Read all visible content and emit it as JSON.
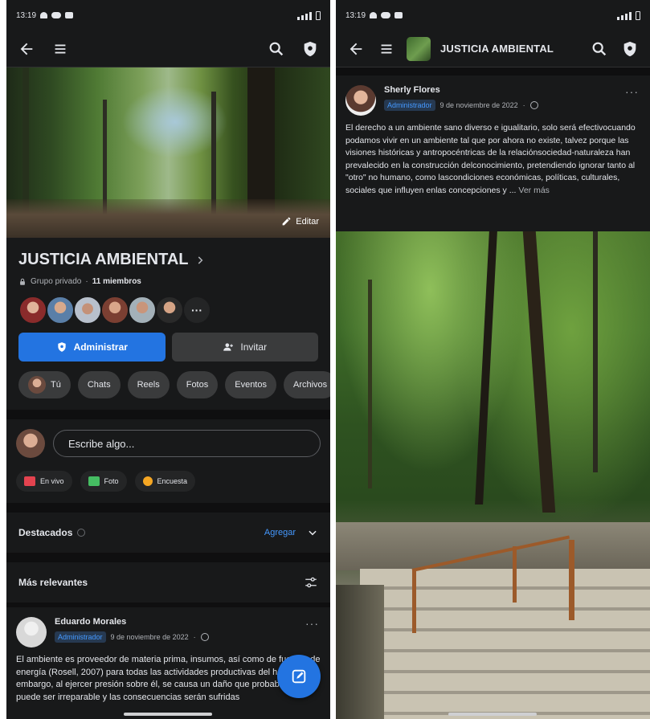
{
  "status_bar": {
    "time": "13:19"
  },
  "left": {
    "cover": {
      "edit_label": "Editar"
    },
    "group": {
      "name": "JUSTICIA AMBIENTAL",
      "privacy": "Grupo privado",
      "members": "11 miembros"
    },
    "buttons": {
      "admin": "Administrar",
      "invite": "Invitar"
    },
    "chips": [
      "Tú",
      "Chats",
      "Reels",
      "Fotos",
      "Eventos",
      "Archivos"
    ],
    "composer": {
      "placeholder": "Escribe algo...",
      "options": [
        {
          "label": "En vivo",
          "color": "#e4434f"
        },
        {
          "label": "Foto",
          "color": "#45bd62"
        },
        {
          "label": "Encuesta",
          "color": "#f5a623"
        }
      ]
    },
    "featured": {
      "title": "Destacados",
      "add": "Agregar"
    },
    "relevant": {
      "title": "Más relevantes"
    },
    "post": {
      "author": "Eduardo Morales",
      "role": "Administrador",
      "date": "9 de noviembre de 2022",
      "text": "El ambiente es proveedor de materia prima, insumos, así como de fuentes de energía (Rosell, 2007) para todas las actividades productivas del hombre. Sin embargo, al ejercer presión sobre él, se causa un daño que probablemente puede ser irreparable y las consecuencias serán sufridas"
    }
  },
  "right": {
    "appbar": {
      "title": "JUSTICIA AMBIENTAL"
    },
    "post": {
      "author": "Sherly Flores",
      "role": "Administrador",
      "date": "9 de noviembre de 2022",
      "text": "El derecho a un ambiente sano diverso e igualitario, solo será efectivocuando podamos vivir en un ambiente tal que por ahora no existe, talvez porque las visiones históricas y antropocéntricas de la relaciónsociedad-naturaleza han prevalecido en la construcción delconocimiento, pretendiendo ignorar tanto al \"otro\" no humano, como lascondiciones económicas, políticas, culturales, sociales que influyen enlas concepciones y ...",
      "see_more": "Ver más"
    }
  },
  "colors": {
    "accent": "#2374e1",
    "background": "#18191a",
    "chip": "#3a3b3c",
    "link": "#4599ff"
  }
}
